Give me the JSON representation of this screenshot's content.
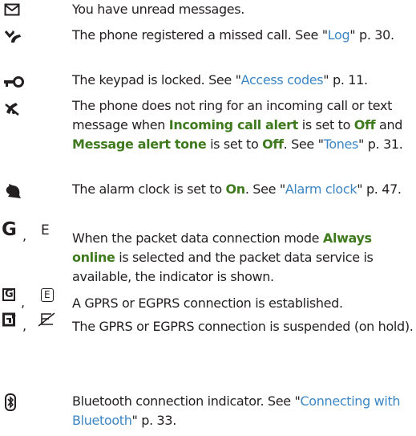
{
  "colors": {
    "text": "#231f20",
    "bold_term": "#3f7b1e",
    "link": "#3c86c4"
  },
  "entries": [
    {
      "icons": [
        "envelope-icon"
      ],
      "text": "You have unread messages."
    },
    {
      "icons": [
        "missed-call-icon"
      ],
      "text_1": "The phone registered a missed call. See \"",
      "link_1": "Log",
      "text_2": "\" p. 30."
    },
    {
      "icons": [
        "key-lock-icon"
      ],
      "text_1": "The keypad is locked. See \"",
      "link_1": "Access codes",
      "text_2": "\" p. 11."
    },
    {
      "icons": [
        "silent-icon"
      ],
      "text_1": "The phone does not ring for an incoming call or text message when ",
      "bold_1": "Incoming call alert",
      "text_2": " is set to ",
      "bold_2": "Off",
      "text_3": " and ",
      "bold_3": "Message alert tone",
      "text_4": " is set to ",
      "bold_4": "Off",
      "text_5": ". See \"",
      "link_1": "Tones",
      "text_6": "\" p. 31."
    },
    {
      "icons": [
        "alarm-clock-icon"
      ],
      "text_1": "The alarm clock is set to ",
      "bold_1": "On",
      "text_2": ". See \"",
      "link_1": "Alarm clock",
      "text_3": "\" p. 47."
    },
    {
      "icons": [
        "gprs-G-icon",
        "egprs-E-icon"
      ],
      "icon_labels": [
        "G",
        "E"
      ],
      "separator": ",",
      "text_1": "When the packet data connection mode ",
      "bold_1": "Always online",
      "text_2": " is selected and the packet data service is available, the indicator is shown."
    },
    {
      "icons": [
        "gprs-connected-icon",
        "egprs-connected-icon"
      ],
      "icon_labels": [
        "G",
        "E"
      ],
      "separator": ",",
      "text": "A GPRS or EGPRS connection is established."
    },
    {
      "icons": [
        "gprs-suspended-icon",
        "egprs-suspended-icon"
      ],
      "separator": ",",
      "text": "The GPRS or EGPRS connection is suspended (on hold)."
    },
    {
      "icons": [
        "bluetooth-icon"
      ],
      "text_1": "Bluetooth connection indicator. See \"",
      "link_1": "Connecting with Bluetooth",
      "text_2": "\" p. 33."
    }
  ]
}
